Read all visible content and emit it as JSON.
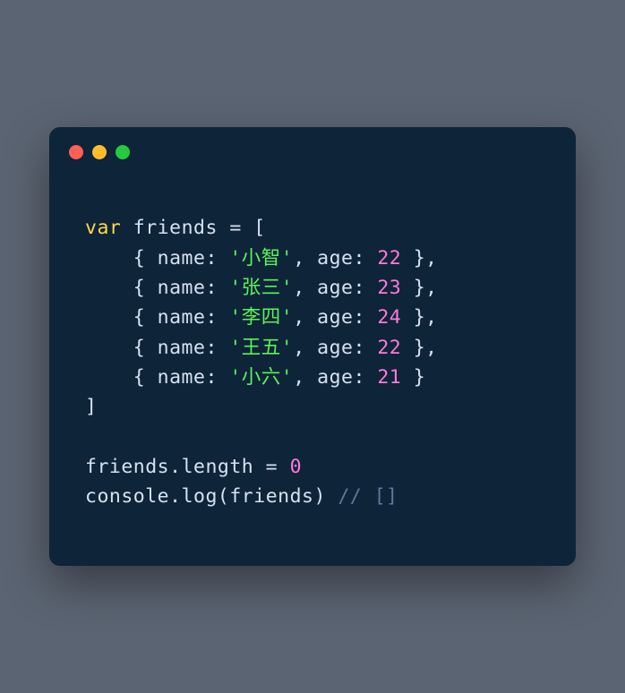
{
  "code": {
    "l1_kw": "var",
    "l1_sp": " ",
    "l1_id": "friends",
    "l1_rest": " = [",
    "l2_indent": "    { ",
    "l2_name": "name",
    "l2_colon": ": ",
    "l2_str": "'小智'",
    "l2_comma": ", ",
    "l2_age": "age",
    "l2_colon2": ": ",
    "l2_num": "22",
    "l2_end": " },",
    "l3_indent": "    { ",
    "l3_name": "name",
    "l3_colon": ": ",
    "l3_str": "'张三'",
    "l3_comma": ", ",
    "l3_age": "age",
    "l3_colon2": ": ",
    "l3_num": "23",
    "l3_end": " },",
    "l4_indent": "    { ",
    "l4_name": "name",
    "l4_colon": ": ",
    "l4_str": "'李四'",
    "l4_comma": ", ",
    "l4_age": "age",
    "l4_colon2": ": ",
    "l4_num": "24",
    "l4_end": " },",
    "l5_indent": "    { ",
    "l5_name": "name",
    "l5_colon": ": ",
    "l5_str": "'王五'",
    "l5_comma": ", ",
    "l5_age": "age",
    "l5_colon2": ": ",
    "l5_num": "22",
    "l5_end": " },",
    "l6_indent": "    { ",
    "l6_name": "name",
    "l6_colon": ": ",
    "l6_str": "'小六'",
    "l6_comma": ", ",
    "l6_age": "age",
    "l6_colon2": ": ",
    "l6_num": "21",
    "l6_end": " }",
    "l7": "]",
    "l8": "",
    "l9_a": "friends",
    "l9_b": ".",
    "l9_c": "length",
    "l9_d": " = ",
    "l9_e": "0",
    "l10_a": "console",
    "l10_b": ".",
    "l10_c": "log",
    "l10_d": "(",
    "l10_e": "friends",
    "l10_f": ") ",
    "l10_g": "// []"
  }
}
